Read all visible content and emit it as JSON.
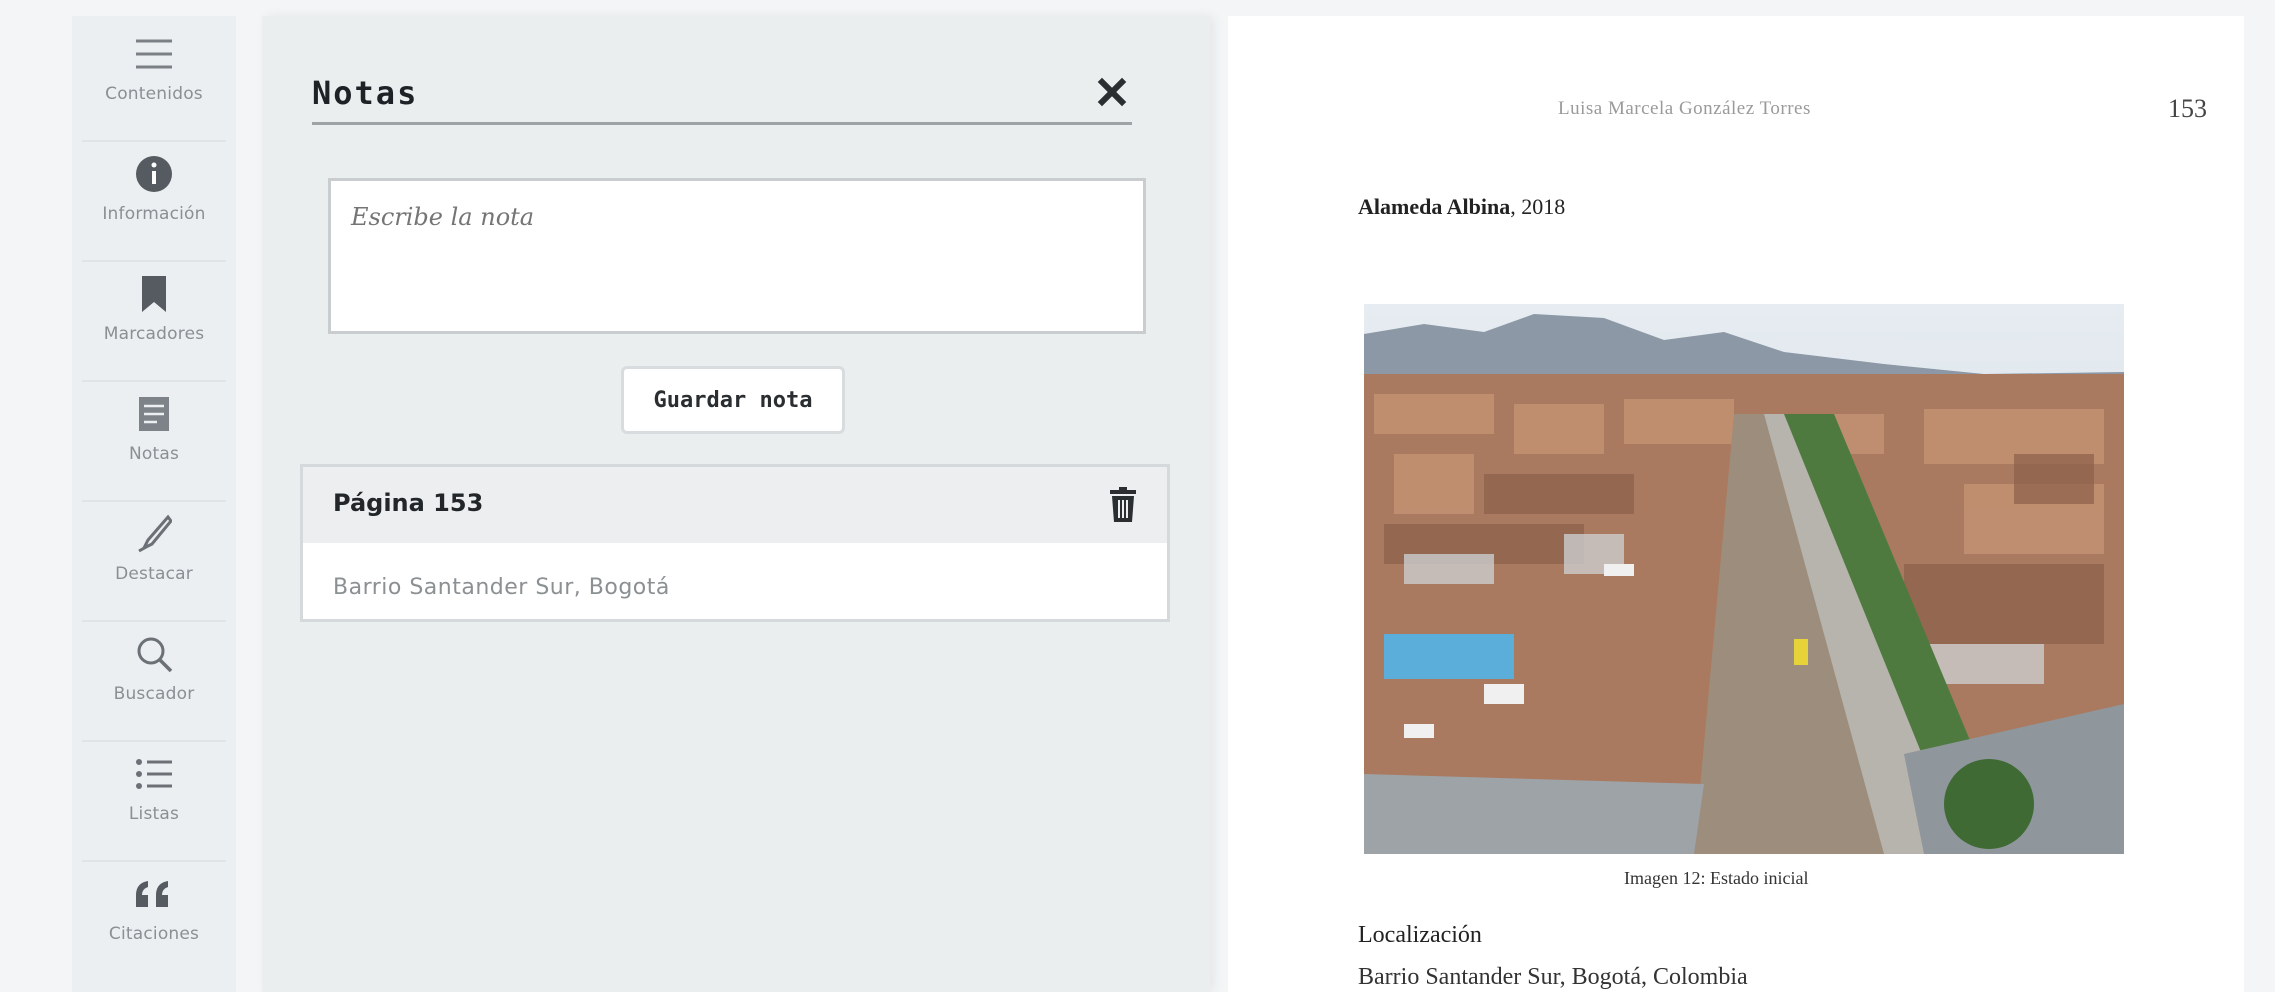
{
  "toolbar": {
    "items": [
      {
        "label": "Contenidos",
        "icon": "contents-icon"
      },
      {
        "label": "Información",
        "icon": "info-icon"
      },
      {
        "label": "Marcadores",
        "icon": "bookmark-icon"
      },
      {
        "label": "Notas",
        "icon": "notes-icon"
      },
      {
        "label": "Destacar",
        "icon": "highlighter-icon"
      },
      {
        "label": "Buscador",
        "icon": "search-icon"
      },
      {
        "label": "Listas",
        "icon": "list-icon"
      },
      {
        "label": "Citaciones",
        "icon": "quote-icon"
      }
    ]
  },
  "notes": {
    "title": "Notas",
    "input_placeholder": "Escribe la nota",
    "save_label": "Guardar nota",
    "saved": [
      {
        "page": "Página 153",
        "text": "Barrio Santander Sur, Bogotá"
      }
    ]
  },
  "document": {
    "running_head": "Luisa Marcela González Torres",
    "page_number": "153",
    "heading_bold": "Alameda Albina",
    "heading_rest": ", 2018",
    "caption": "Imagen 12: Estado inicial",
    "location_label": "Localización",
    "location_value": "Barrio Santander Sur, Bogotá, Colombia"
  },
  "colors": {
    "accent": "#1e2226",
    "panel_bg": "#ebeeee",
    "toolbar_bg": "#eceff1",
    "page_bg": "#ffffff"
  }
}
